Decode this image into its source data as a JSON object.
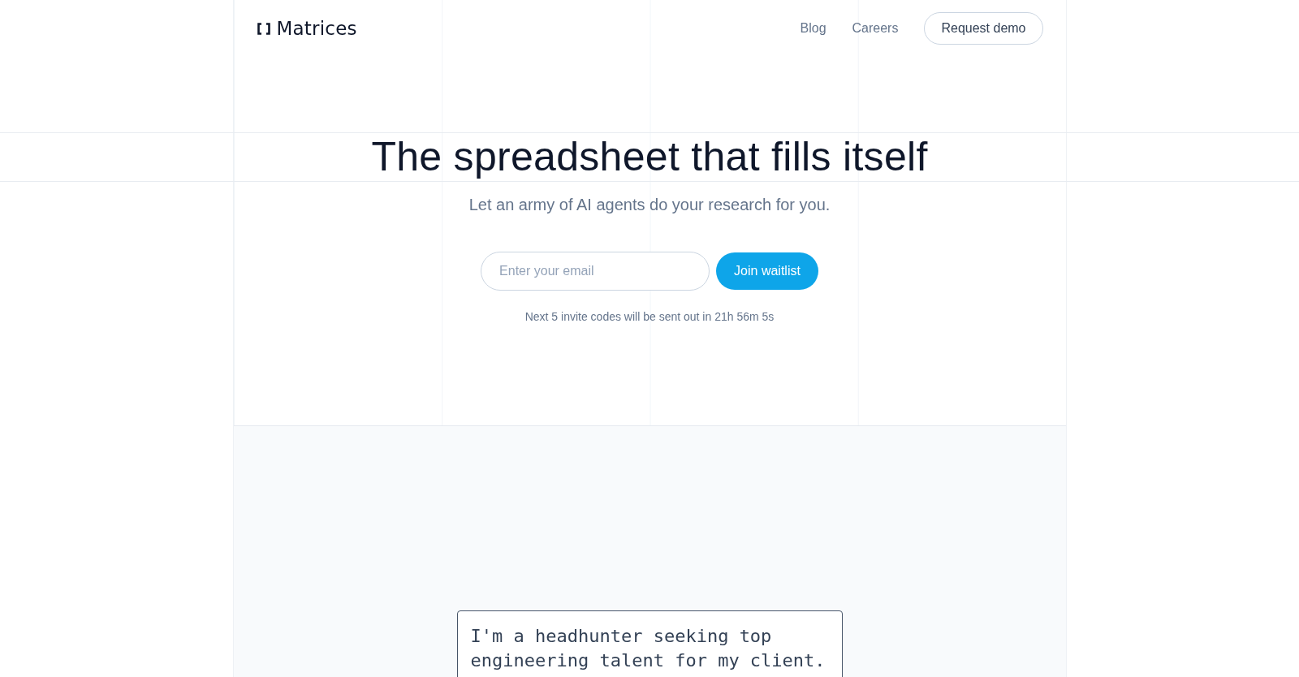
{
  "header": {
    "logo": "Matrices",
    "nav_links": [
      "Blog",
      "Careers"
    ],
    "demo_button": "Request demo"
  },
  "hero": {
    "title": "The spreadsheet that fills itself",
    "subtitle": "Let an army of AI agents do your research for you.",
    "email_field": {
      "placeholder": "Enter your email"
    },
    "join_button": "Join waitlist",
    "countdown": "Next 5 invite codes will be sent out in 21h 56m 5s"
  },
  "prompt_box": {
    "value": "I'm a headhunter seeking top engineering talent for my client."
  }
}
